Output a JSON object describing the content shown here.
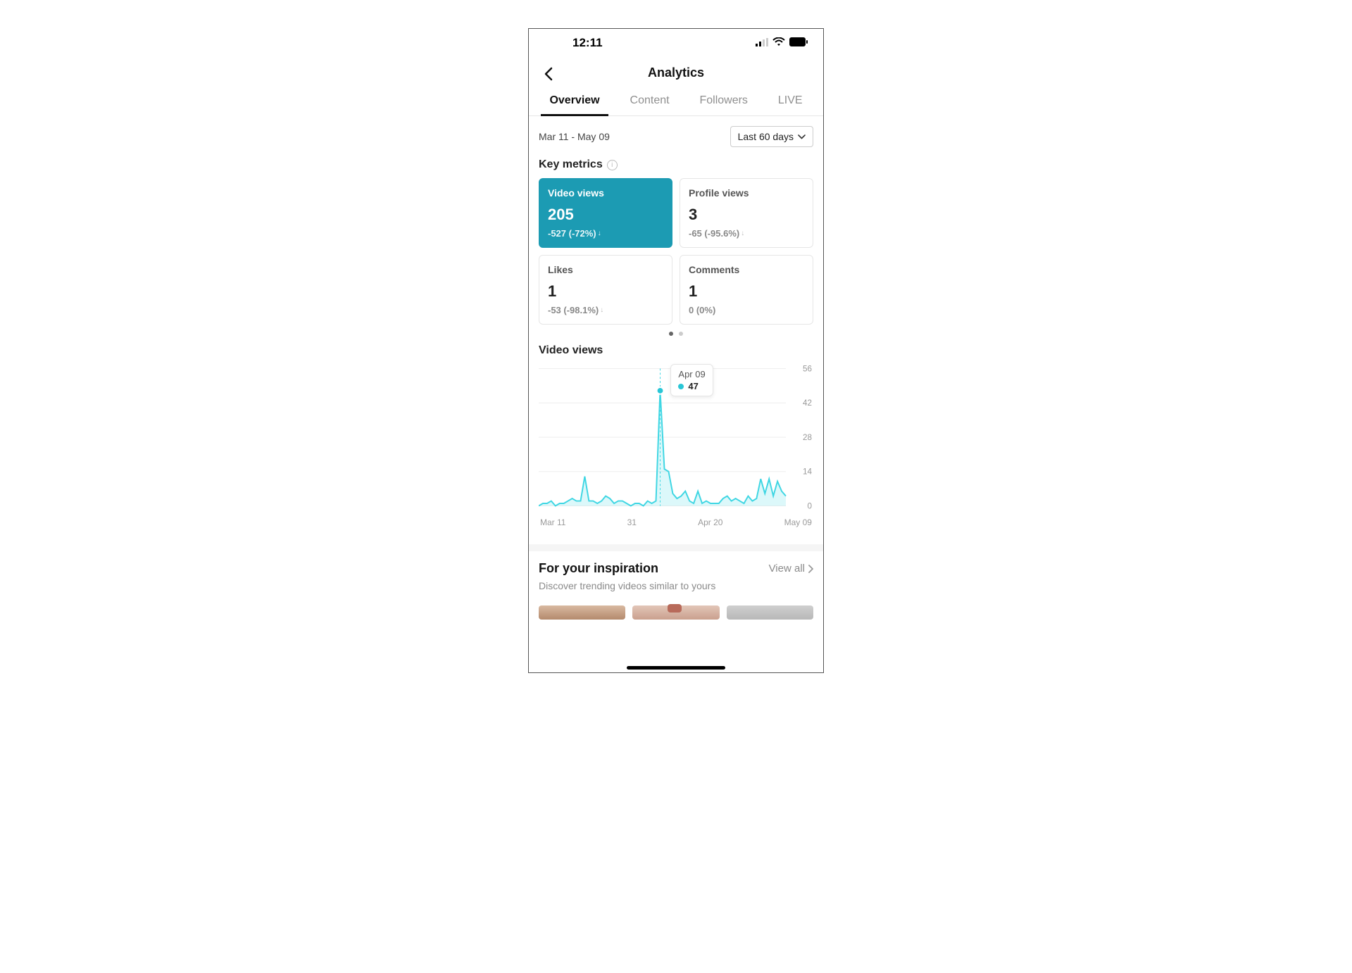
{
  "status_bar": {
    "time": "12:11"
  },
  "header": {
    "title": "Analytics"
  },
  "tabs": [
    {
      "label": "Overview",
      "active": true
    },
    {
      "label": "Content",
      "active": false
    },
    {
      "label": "Followers",
      "active": false
    },
    {
      "label": "LIVE",
      "active": false
    }
  ],
  "date_range": "Mar 11 - May 09",
  "range_selector": "Last 60 days",
  "key_metrics_title": "Key metrics",
  "metrics": [
    {
      "label": "Video views",
      "value": "205",
      "delta": "-527 (-72%)",
      "trend": "down",
      "selected": true
    },
    {
      "label": "Profile views",
      "value": "3",
      "delta": "-65 (-95.6%)",
      "trend": "down",
      "selected": false
    },
    {
      "label": "Likes",
      "value": "1",
      "delta": "-53 (-98.1%)",
      "trend": "down",
      "selected": false
    },
    {
      "label": "Comments",
      "value": "1",
      "delta": "0 (0%)",
      "trend": "flat",
      "selected": false
    }
  ],
  "pagination": {
    "pages": 2,
    "active": 0
  },
  "chart_title": "Video views",
  "chart_tooltip": {
    "date": "Apr 09",
    "value": "47"
  },
  "chart_x_ticks": [
    "Mar 11",
    "31",
    "Apr 20",
    "May 09"
  ],
  "chart_y_ticks": [
    "56",
    "42",
    "28",
    "14",
    "0"
  ],
  "inspiration": {
    "title": "For your inspiration",
    "view_all": "View all",
    "subtitle": "Discover trending videos similar to yours"
  },
  "colors": {
    "accent": "#1c9bb3",
    "chart_line": "#3ed6e3"
  },
  "chart_data": {
    "type": "line",
    "title": "Video views",
    "xlabel": "",
    "ylabel": "",
    "ylim": [
      0,
      56
    ],
    "x_tick_labels": [
      "Mar 11",
      "31",
      "Apr 20",
      "May 09"
    ],
    "y_tick_labels": [
      0,
      14,
      28,
      42,
      56
    ],
    "highlight": {
      "date": "Apr 09",
      "value": 47
    },
    "x": [
      "Mar 11",
      "Mar 12",
      "Mar 13",
      "Mar 14",
      "Mar 15",
      "Mar 16",
      "Mar 17",
      "Mar 18",
      "Mar 19",
      "Mar 20",
      "Mar 21",
      "Mar 22",
      "Mar 23",
      "Mar 24",
      "Mar 25",
      "Mar 26",
      "Mar 27",
      "Mar 28",
      "Mar 29",
      "Mar 30",
      "Mar 31",
      "Apr 01",
      "Apr 02",
      "Apr 03",
      "Apr 04",
      "Apr 05",
      "Apr 06",
      "Apr 07",
      "Apr 08",
      "Apr 09",
      "Apr 10",
      "Apr 11",
      "Apr 12",
      "Apr 13",
      "Apr 14",
      "Apr 15",
      "Apr 16",
      "Apr 17",
      "Apr 18",
      "Apr 19",
      "Apr 20",
      "Apr 21",
      "Apr 22",
      "Apr 23",
      "Apr 24",
      "Apr 25",
      "Apr 26",
      "Apr 27",
      "Apr 28",
      "Apr 29",
      "Apr 30",
      "May 01",
      "May 02",
      "May 03",
      "May 04",
      "May 05",
      "May 06",
      "May 07",
      "May 08",
      "May 09"
    ],
    "values": [
      0,
      1,
      1,
      2,
      0,
      1,
      1,
      2,
      3,
      2,
      2,
      12,
      2,
      2,
      1,
      2,
      4,
      3,
      1,
      2,
      2,
      1,
      0,
      1,
      1,
      0,
      2,
      1,
      2,
      47,
      15,
      14,
      5,
      3,
      4,
      6,
      2,
      1,
      6,
      1,
      2,
      1,
      1,
      1,
      3,
      4,
      2,
      3,
      2,
      1,
      4,
      2,
      3,
      11,
      5,
      11,
      4,
      10,
      6,
      4
    ]
  }
}
